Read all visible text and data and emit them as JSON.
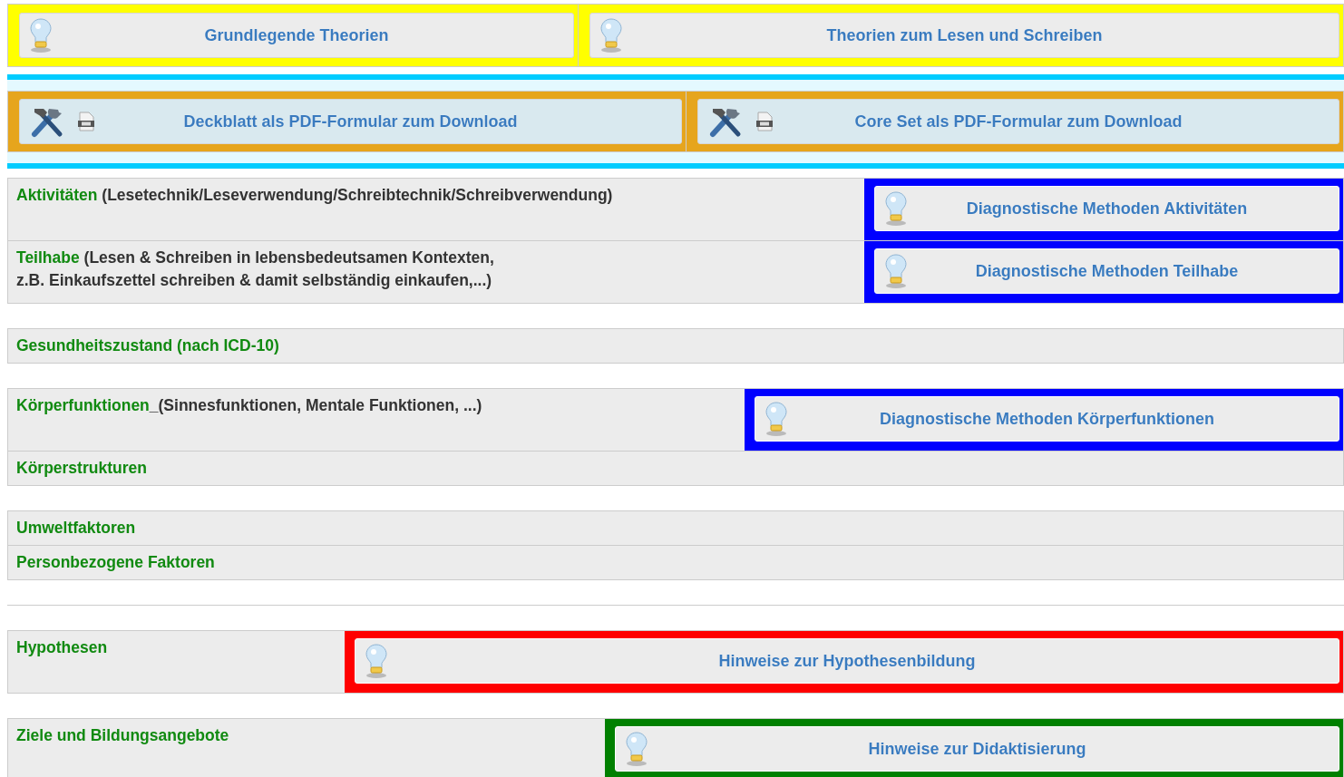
{
  "bands": [
    {
      "kind": "theory",
      "buttons": [
        "Grundlegende Theorien",
        "Theorien zum Lesen und Schreiben"
      ]
    },
    {
      "kind": "download",
      "buttons": [
        "Deckblatt als PDF-Formular zum Download",
        "Core Set als PDF-Formular zum Download"
      ]
    }
  ],
  "sections": [
    {
      "rows": [
        {
          "title": "Aktivitäten",
          "detail": "(Lesetechnik/Leseverwendung/Schreibtechnik/Schreibverwendung)",
          "button": {
            "label": "Diagnostische Methoden Aktivitäten",
            "color": "#0000ff"
          }
        },
        {
          "title": "Teilhabe",
          "detail": "(Lesen & Schreiben in lebensbedeutsamen Kontexten,\nz.B. Einkaufszettel schreiben & damit selbständig einkaufen,...)",
          "button": {
            "label": "Diagnostische Methoden Teilhabe",
            "color": "#0000ff"
          }
        }
      ]
    },
    {
      "rows": [
        {
          "title": "Gesundheitszustand (nach ICD-10)"
        }
      ]
    },
    {
      "rows": [
        {
          "title": "Körperfunktionen",
          "detail": "_(Sinnesfunktionen, Mentale Funktionen, ...)",
          "button": {
            "label": "Diagnostische Methoden Körperfunktionen",
            "color": "#0000ff"
          }
        },
        {
          "title": "Körperstrukturen"
        }
      ]
    },
    {
      "rows": [
        {
          "title": "Umweltfaktoren"
        },
        {
          "title": "Personbezogene Faktoren"
        }
      ]
    },
    {
      "rows": [
        {
          "title": "Hypothesen",
          "button": {
            "label": "Hinweise zur Hypothesenbildung",
            "color": "#ff0000"
          }
        }
      ]
    },
    {
      "rows": [
        {
          "title": "Ziele und Bildungsangebote",
          "button": {
            "label": "Hinweise zur Didaktisierung",
            "color": "#008000"
          }
        }
      ]
    }
  ]
}
